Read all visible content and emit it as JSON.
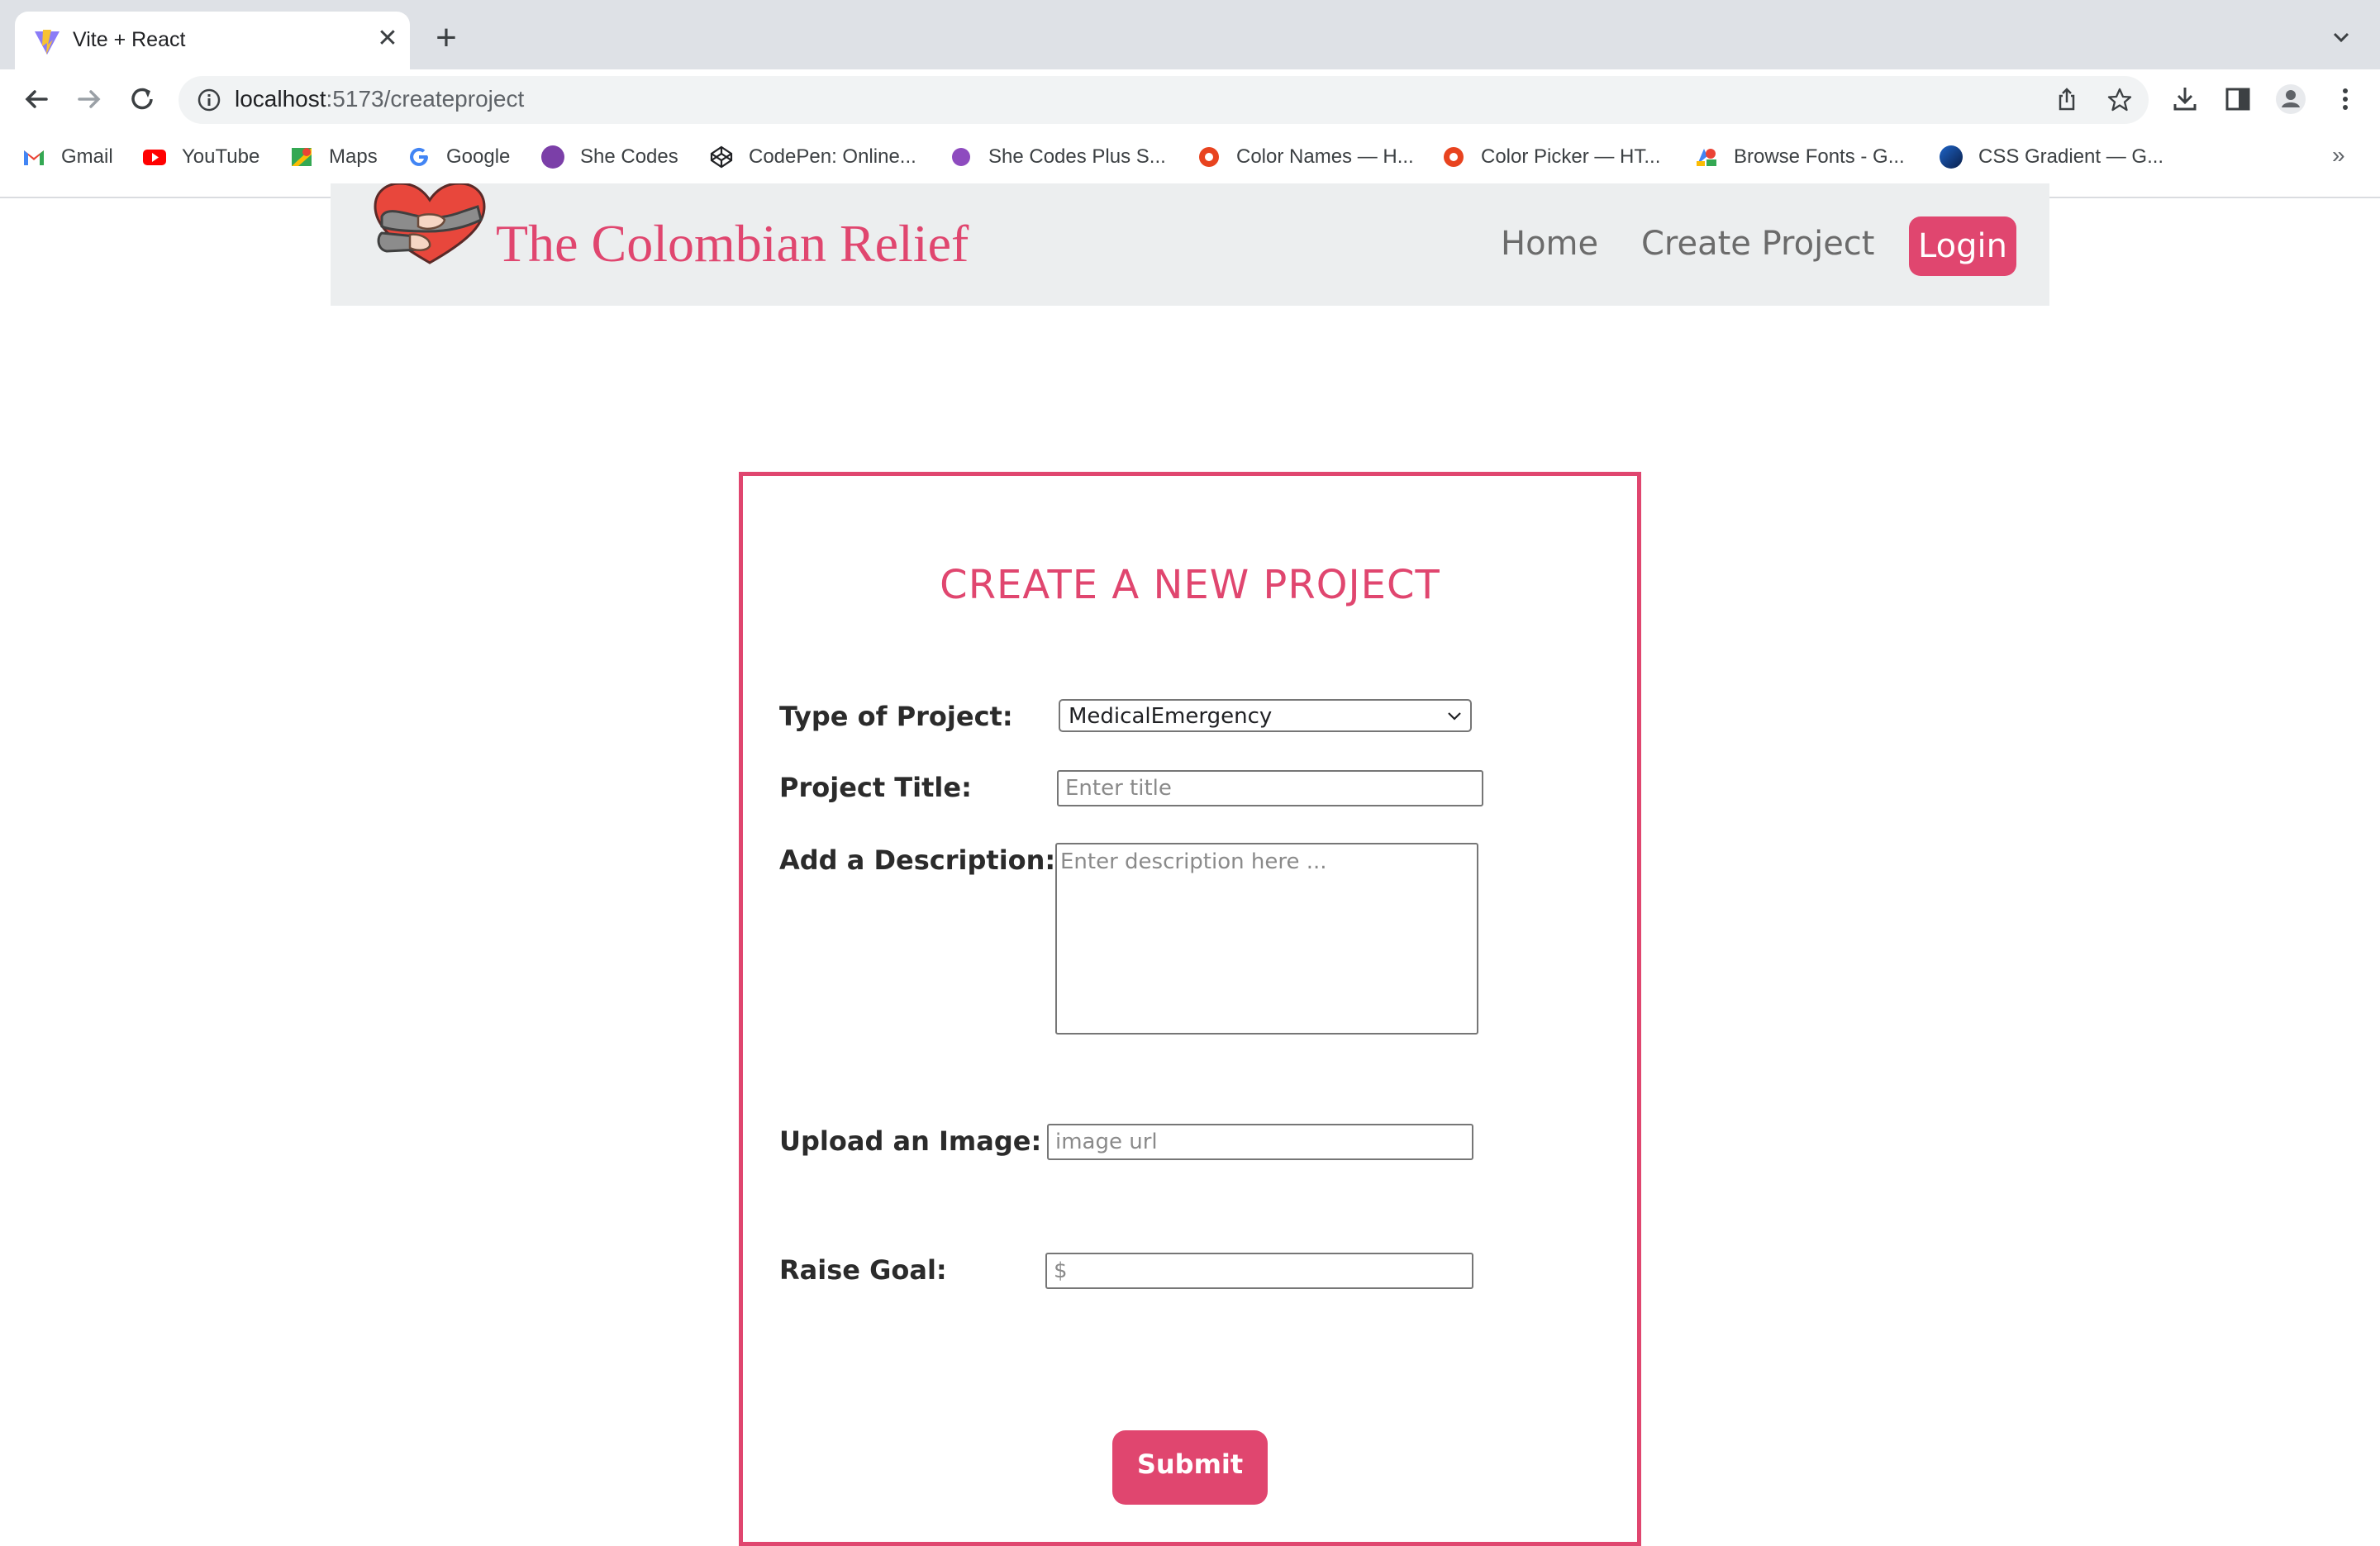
{
  "browser": {
    "tab": {
      "title": "Vite + React"
    },
    "url": {
      "host": "localhost",
      "path": ":5173/createproject"
    },
    "bookmarks": [
      {
        "label": "Gmail",
        "icon": "gmail-icon"
      },
      {
        "label": "YouTube",
        "icon": "youtube-icon"
      },
      {
        "label": "Maps",
        "icon": "maps-icon"
      },
      {
        "label": "Google",
        "icon": "google-icon"
      },
      {
        "label": "She Codes",
        "icon": "she-codes-icon"
      },
      {
        "label": "CodePen: Online...",
        "icon": "codepen-icon"
      },
      {
        "label": "She Codes Plus S...",
        "icon": "she-codes-plus-icon"
      },
      {
        "label": "Color Names — H...",
        "icon": "color-names-icon"
      },
      {
        "label": "Color Picker — HT...",
        "icon": "color-picker-icon"
      },
      {
        "label": "Browse Fonts - G...",
        "icon": "google-fonts-icon"
      },
      {
        "label": "CSS Gradient — G...",
        "icon": "css-gradient-icon"
      }
    ],
    "more_bookmarks": "»"
  },
  "site": {
    "brand": "The Colombian Relief",
    "nav": {
      "home": "Home",
      "create_project": "Create Project",
      "login": "Login"
    }
  },
  "form": {
    "heading": "CREATE A NEW PROJECT",
    "type_label": "Type of Project:",
    "type_value": "MedicalEmergency",
    "title_label": "Project Title:",
    "title_placeholder": "Enter title",
    "description_label": "Add a Description:",
    "description_placeholder": "Enter description here ...",
    "image_label": "Upload an Image:",
    "image_placeholder": "image url",
    "goal_label": "Raise Goal:",
    "goal_placeholder": "$",
    "submit_label": "Submit"
  },
  "colors": {
    "accent": "#e0466f",
    "header_bg": "#eceeef",
    "nav_text": "#6b6b6b"
  }
}
